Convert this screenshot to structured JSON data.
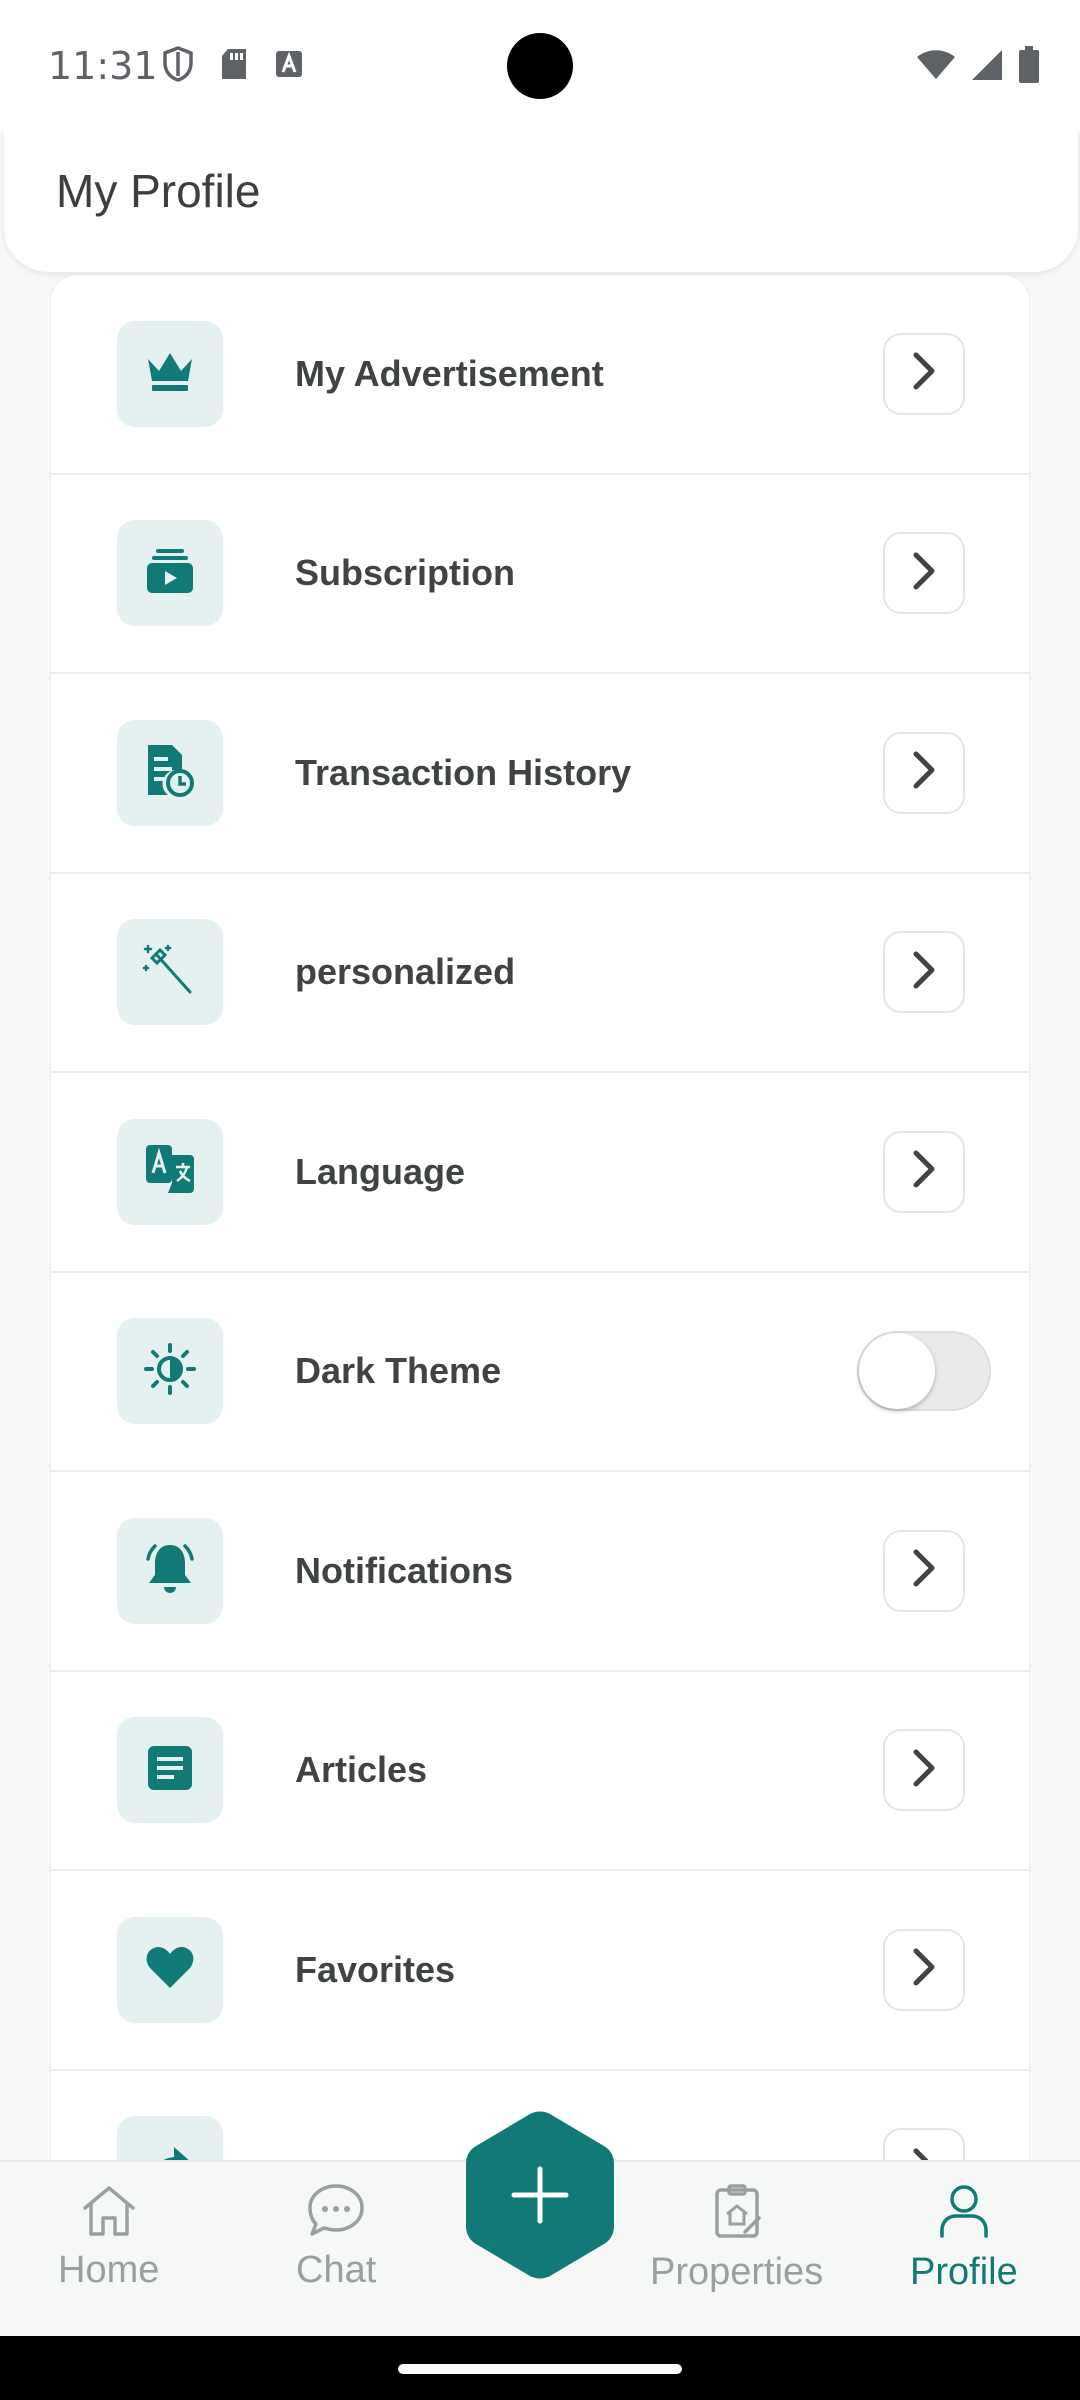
{
  "status_bar": {
    "time": "11:31"
  },
  "header": {
    "title": "My Profile"
  },
  "menu": {
    "items": [
      {
        "label": "My Advertisement",
        "icon": "crown-icon"
      },
      {
        "label": "Subscription",
        "icon": "subscription-icon"
      },
      {
        "label": "Transaction History",
        "icon": "transaction-history-icon"
      },
      {
        "label": "personalized",
        "icon": "magic-wand-icon"
      },
      {
        "label": "Language",
        "icon": "translate-icon"
      },
      {
        "label": "Dark Theme",
        "icon": "brightness-icon",
        "toggle_on": false
      },
      {
        "label": "Notifications",
        "icon": "bell-icon"
      },
      {
        "label": "Articles",
        "icon": "article-icon"
      },
      {
        "label": "Favorites",
        "icon": "heart-icon"
      }
    ]
  },
  "bottom_nav": {
    "home": "Home",
    "chat": "Chat",
    "properties": "Properties",
    "profile": "Profile",
    "active": "profile"
  },
  "colors": {
    "accent": "#127a76",
    "icon_tile_bg": "#e4f1f0",
    "text": "#3f4344",
    "inactive_nav": "#9aa0a0"
  }
}
